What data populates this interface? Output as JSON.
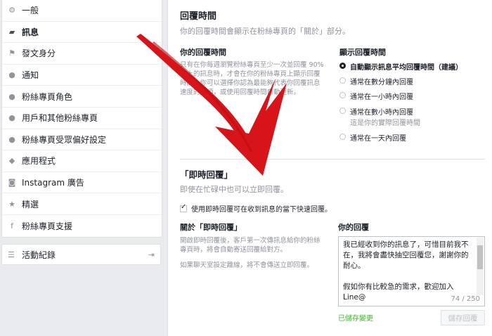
{
  "sidebar": {
    "items": [
      {
        "label": "一般",
        "icon": "gear-icon",
        "glyph": "⚙"
      },
      {
        "label": "訊息",
        "icon": "message-icon",
        "glyph": "▰",
        "active": true
      },
      {
        "label": "發文身分",
        "icon": "flag-icon",
        "glyph": "⚑"
      },
      {
        "label": "通知",
        "icon": "globe-icon",
        "glyph": "●"
      },
      {
        "label": "粉絲專頁角色",
        "icon": "person-icon",
        "glyph": "●"
      },
      {
        "label": "用戶和其他粉絲專頁",
        "icon": "person-plus-icon",
        "glyph": "●"
      },
      {
        "label": "粉絲專頁受眾偏好設定",
        "icon": "people-icon",
        "glyph": "●"
      },
      {
        "label": "應用程式",
        "icon": "cube-icon",
        "glyph": "◆"
      },
      {
        "label": "Instagram 廣告",
        "icon": "instagram-icon",
        "glyph": "◙"
      },
      {
        "label": "精選",
        "icon": "star-icon",
        "glyph": "★"
      },
      {
        "label": "粉絲專頁支援",
        "icon": "facebook-icon",
        "glyph": "f"
      }
    ],
    "activity": {
      "label": "活動紀錄",
      "icon": "list-icon",
      "glyph": "☰",
      "exit_glyph": "⇥"
    }
  },
  "response_time": {
    "title": "回覆時間",
    "desc": "你的回覆時間會顯示在粉絲專頁的「關於」部分。",
    "left_title": "你的回覆時間",
    "left_text": "只有在你每週瀏覽粉絲專頁至少一次並回覆 90% 以上的訊息時，才會在你的粉絲專頁上顯示回覆時間。你可以選擇你認為最能夠代表你回覆訊息速度的選項，或使用回覆時間自動更新。",
    "right_title": "顯示回覆時間",
    "options": [
      {
        "label": "自動顯示訊息平均回覆時間（建議）",
        "sub": "",
        "selected": true
      },
      {
        "label": "通常在數分鐘內回覆",
        "sub": "",
        "selected": false
      },
      {
        "label": "通常在一小時內回覆",
        "sub": "",
        "selected": false
      },
      {
        "label": "通常在數小時內回覆",
        "sub": "這是你的實際回覆時間",
        "selected": false
      },
      {
        "label": "通常在一天內回覆",
        "sub": "",
        "selected": false
      }
    ]
  },
  "instant_reply": {
    "title": "「即時回覆」",
    "desc": "即使在忙碌中也可以立即回覆。",
    "checkbox_label": "使用即時回覆可在收到訊息的當下快速回覆。",
    "about_title": "關於「即時回覆」",
    "about_text1": "開啟即時回覆後，客戶第一次傳訊息給你的粉絲專頁時，將會自動寄送回覆給對方。",
    "about_text2": "如果聊天室設定離線，將不會傳送立即回覆。",
    "reply_title": "你的回覆",
    "reply_text": "我已經收到你的訊息了，可惜目前我不在，我將會盡快抽空回覆您，謝謝你的耐心。\n\n假如你有比較急的需求，歡迎加入Line@",
    "counter": "74 / 250",
    "saved": "已儲存變更",
    "save_button": "儲存回覆"
  },
  "colors": {
    "accent_arrow": "#d8141b",
    "saved_green": "#42b72a"
  }
}
